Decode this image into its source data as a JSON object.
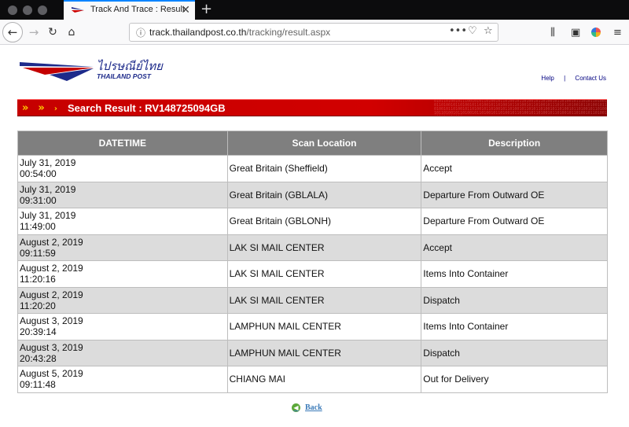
{
  "browser": {
    "tab_title": "Track And Trace : Result",
    "tab_close": "✕",
    "new_tab": "+",
    "url_host": "track.thailandpost.co.th",
    "url_path": "/tracking/result.aspx",
    "icons": [
      "back-arrow",
      "forward-arrow",
      "reload",
      "home",
      "info",
      "page-actions",
      "pocket",
      "bookmark-star",
      "library",
      "sidebar",
      "profile",
      "hamburger-menu"
    ]
  },
  "site": {
    "logo_thai": "ไปรษณีย์ไทย",
    "logo_en": "THAILAND POST",
    "links": {
      "help": "Help",
      "separator": "|",
      "contact": "Contact Us"
    }
  },
  "banner": {
    "text": "Search Result : RV148725094GB",
    "arrow_glyph": "»",
    "arrow_color": "#ffcc00",
    "bg_color": "#c60000"
  },
  "table": {
    "headers": {
      "datetime": "DATETIME",
      "location": "Scan Location",
      "description": "Description"
    },
    "rows": [
      {
        "date": "July 31, 2019",
        "time": "00:54:00",
        "location": "Great Britain (Sheffield)",
        "description": "Accept"
      },
      {
        "date": "July 31, 2019",
        "time": "09:31:00",
        "location": "Great Britain (GBLALA)",
        "description": "Departure From Outward OE"
      },
      {
        "date": "July 31, 2019",
        "time": "11:49:00",
        "location": "Great Britain (GBLONH)",
        "description": "Departure From Outward OE"
      },
      {
        "date": "August 2, 2019",
        "time": "09:11:59",
        "location": "LAK SI MAIL CENTER",
        "description": "Accept"
      },
      {
        "date": "August 2, 2019",
        "time": "11:20:16",
        "location": "LAK SI MAIL CENTER",
        "description": "Items Into Container"
      },
      {
        "date": "August 2, 2019",
        "time": "11:20:20",
        "location": "LAK SI MAIL CENTER",
        "description": "Dispatch"
      },
      {
        "date": "August 3, 2019",
        "time": "20:39:14",
        "location": "LAMPHUN MAIL CENTER",
        "description": "Items Into Container"
      },
      {
        "date": "August 3, 2019",
        "time": "20:43:28",
        "location": "LAMPHUN MAIL CENTER",
        "description": "Dispatch"
      },
      {
        "date": "August 5, 2019",
        "time": "09:11:48",
        "location": "CHIANG MAI",
        "description": "Out for Delivery"
      }
    ],
    "header_bg": "#7f7f7f",
    "alt_row_bg": "#dcdcdc"
  },
  "back_link": {
    "label": "Back",
    "icon": "back-circle-icon",
    "color": "#3a7ab8"
  }
}
